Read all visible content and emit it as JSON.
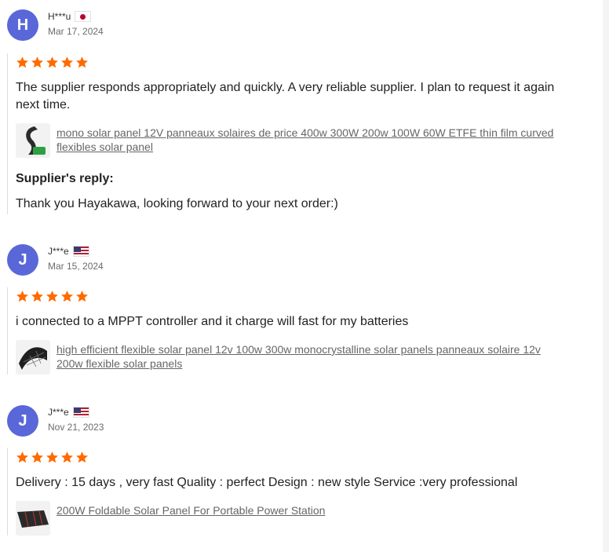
{
  "reviews": [
    {
      "avatar_letter": "H",
      "name": "H***u",
      "country": "jp-flag",
      "date": "Mar 17, 2024",
      "rating": 5,
      "comment": "The supplier responds appropriately and quickly. A very reliable supplier. I plan to request it again next time.",
      "product_title": "mono solar panel 12V panneaux solaires de price 400w 300W 200w 100W 60W ETFE thin film curved flexibles solar panel",
      "reply_title": "Supplier's reply:",
      "reply_text": "Thank you Hayakawa, looking forward to your next order:)"
    },
    {
      "avatar_letter": "J",
      "name": "J***e",
      "country": "us-flag",
      "date": "Mar 15, 2024",
      "rating": 5,
      "comment": "i connected to a MPPT controller and it charge will fast for my batteries",
      "product_title": "high efficient flexible solar panel 12v 100w 300w monocrystalline solar panels panneaux solaire 12v 200w flexible solar panels"
    },
    {
      "avatar_letter": "J",
      "name": "J***e",
      "country": "us-flag",
      "date": "Nov 21, 2023",
      "rating": 5,
      "comment": "Delivery : 15 days , very fast Quality : perfect Design : new style Service :very professional",
      "product_title": "200W Foldable Solar Panel For Portable Power Station"
    }
  ],
  "colors": {
    "avatar": "#5a67d8",
    "star": "#ff6a00",
    "link": "#666666"
  }
}
